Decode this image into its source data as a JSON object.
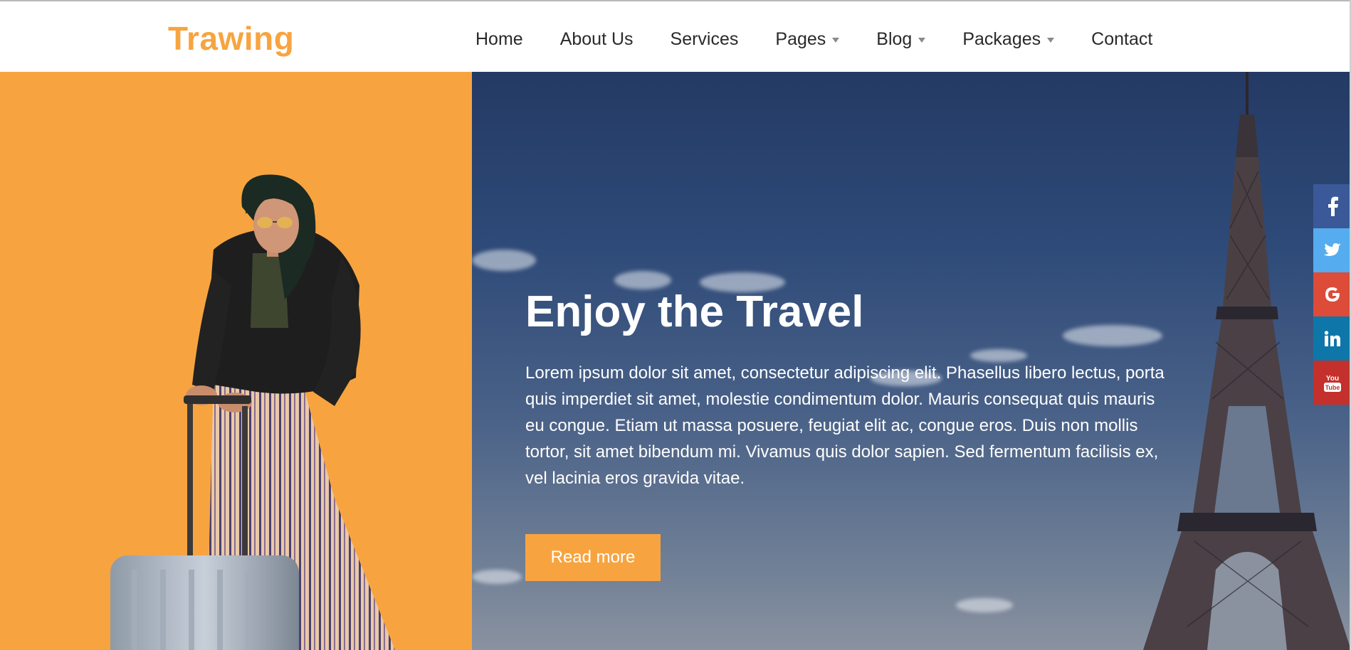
{
  "header": {
    "logo": "Trawing",
    "nav": [
      {
        "label": "Home",
        "dropdown": false
      },
      {
        "label": "About Us",
        "dropdown": false
      },
      {
        "label": "Services",
        "dropdown": false
      },
      {
        "label": "Pages",
        "dropdown": true
      },
      {
        "label": "Blog",
        "dropdown": true
      },
      {
        "label": "Packages",
        "dropdown": true
      },
      {
        "label": "Contact",
        "dropdown": false
      }
    ]
  },
  "hero": {
    "title": "Enjoy the Travel",
    "text": "Lorem ipsum dolor sit amet, consectetur adipiscing elit. Phasellus libero lectus, porta quis imperdiet sit amet, molestie condimentum dolor. Mauris consequat quis mauris eu congue. Etiam ut massa posuere, feugiat elit ac, congue eros. Duis non mollis tortor, sit amet bibendum mi. Vivamus quis dolor sapien. Sed fermentum facilisis ex, vel lacinia eros gravida vitae.",
    "button_label": "Read more"
  },
  "social": [
    {
      "name": "facebook-icon",
      "glyph": "f",
      "color": "#3b5998"
    },
    {
      "name": "twitter-icon",
      "glyph": "twitter",
      "color": "#55acee"
    },
    {
      "name": "google-plus-icon",
      "glyph": "G",
      "color": "#dd4b39"
    },
    {
      "name": "linkedin-icon",
      "glyph": "in",
      "color": "#0e76a8"
    },
    {
      "name": "youtube-icon",
      "glyph": "You Tube",
      "color": "#c4302b"
    }
  ],
  "colors": {
    "accent": "#f7a440",
    "hero_sky": "#2e4a78",
    "text_dark": "#2a2a2a"
  }
}
